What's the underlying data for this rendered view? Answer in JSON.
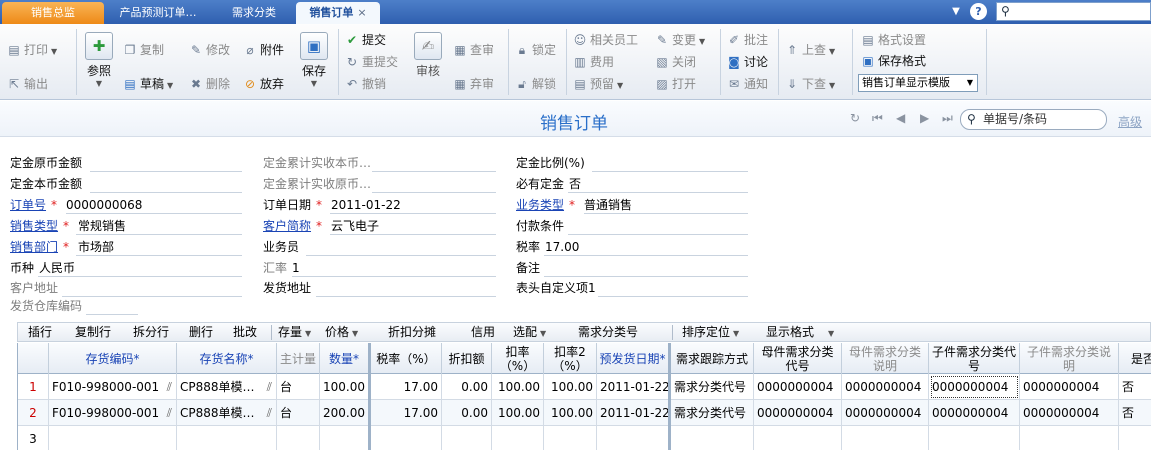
{
  "tabs": [
    {
      "label": "销售总监"
    },
    {
      "label": "产品预测订单…"
    },
    {
      "label": "需求分类"
    },
    {
      "label": "销售订单",
      "close": "×"
    }
  ],
  "toolbar": {
    "print": "打印",
    "export": "输出",
    "reference": "参照",
    "copy": "复制",
    "draft": "草稿",
    "modify": "修改",
    "delete": "删除",
    "attach": "附件",
    "abandon": "放弃",
    "save": "保存",
    "submit": "提交",
    "resubmit": "重提交",
    "revoke": "撤销",
    "audit": "审核",
    "check_audit": "查审",
    "discard_audit": "弃审",
    "lock": "锁定",
    "unlock": "解锁",
    "related_staff": "相关员工",
    "cost": "费用",
    "reserve": "预留",
    "change": "变更",
    "close": "关闭",
    "open": "打开",
    "annotate": "批注",
    "discuss": "讨论",
    "notify": "通知",
    "prev_query": "上查",
    "next_query": "下查",
    "format_settings": "格式设置",
    "save_format": "保存格式",
    "template_select": "销售订单显示模版"
  },
  "page": {
    "title": "销售订单",
    "search_placeholder": "单据号/条码",
    "advanced": "高级"
  },
  "form": {
    "deposit_orig_label": "定金原币金额",
    "deposit_local_label": "定金本币金额",
    "order_no_label": "订单号",
    "order_no_value": "0000000068",
    "sales_type_label": "销售类型",
    "sales_type_value": "常规销售",
    "sales_dept_label": "销售部门",
    "sales_dept_value": "市场部",
    "currency_label": "币种",
    "currency_value": "人民币",
    "customer_addr_label": "客户地址",
    "warehouse_code_label": "发货仓库编码",
    "deposit_recv_local_label": "定金累计实收本币…",
    "deposit_recv_orig_label": "定金累计实收原币…",
    "order_date_label": "订单日期",
    "order_date_value": "2011-01-22",
    "customer_label": "客户简称",
    "customer_value": "云飞电子",
    "salesman_label": "业务员",
    "exchange_rate_label": "汇率",
    "exchange_rate_value": "1",
    "ship_addr_label": "发货地址",
    "deposit_ratio_label": "定金比例(%)",
    "required_deposit_label": "必有定金",
    "required_deposit_value": "否",
    "business_type_label": "业务类型",
    "business_type_value": "普通销售",
    "payment_terms_label": "付款条件",
    "tax_rate_label": "税率",
    "tax_rate_value": "17.00",
    "remark_label": "备注",
    "custom1_label": "表头自定义项1",
    "required_mark": "*"
  },
  "grid_toolbar": {
    "insert": "插行",
    "copy_row": "复制行",
    "split_row": "拆分行",
    "delete_row": "删行",
    "batch_change": "批改",
    "stock": "存量",
    "price": "价格",
    "discount_split": "折扣分摊",
    "credit": "信用",
    "allocate": "选配",
    "demand_class_no": "需求分类号",
    "sort_position": "排序定位",
    "display_format": "显示格式"
  },
  "grid": {
    "headers": {
      "item_code": "存货编码*",
      "item_name": "存货名称*",
      "unit": "主计量",
      "qty": "数量*",
      "tax_rate": "税率（%）",
      "discount_amt": "折扣额",
      "discount1": "扣率\n（%）",
      "discount2": "扣率2\n（%）",
      "ship_date": "预发货日期*",
      "demand_track": "需求跟踪方式",
      "parent_no": "母件需求分类\n代号",
      "parent_desc": "母件需求分类\n说明",
      "child_no": "子件需求分类代\n号",
      "child_desc": "子件需求分类说\n明",
      "is": "是否"
    },
    "rows": [
      {
        "rn": "1",
        "item_code": "F010-998000-001",
        "item_name": "CP888单模…",
        "unit": "台",
        "qty": "100.00",
        "tax_rate": "17.00",
        "discount_amt": "0.00",
        "discount1": "100.00",
        "discount2": "100.00",
        "ship_date": "2011-01-22",
        "demand_track": "需求分类代号",
        "parent_no": "0000000004",
        "parent_desc": "0000000004",
        "child_no": "0000000004",
        "child_desc": "0000000004",
        "is": "否"
      },
      {
        "rn": "2",
        "item_code": "F010-998000-001",
        "item_name": "CP888单模…",
        "unit": "台",
        "qty": "200.00",
        "tax_rate": "17.00",
        "discount_amt": "0.00",
        "discount1": "100.00",
        "discount2": "100.00",
        "ship_date": "2011-01-22",
        "demand_track": "需求分类代号",
        "parent_no": "0000000004",
        "parent_desc": "0000000004",
        "child_no": "0000000004",
        "child_desc": "0000000004",
        "is": "否"
      },
      {
        "rn": "3"
      }
    ]
  }
}
